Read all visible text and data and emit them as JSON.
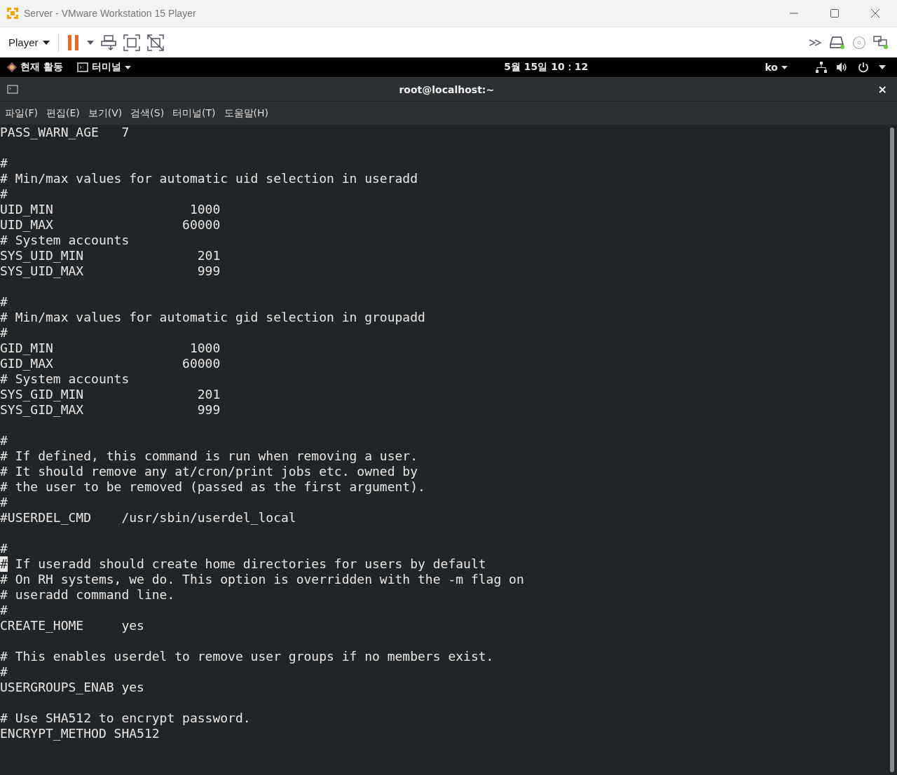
{
  "window": {
    "title": "Server - VMware Workstation 15 Player"
  },
  "toolbar": {
    "player_menu": "Player"
  },
  "top_bar": {
    "activities": "현재 활동",
    "app_menu": "터미널",
    "clock": "5월 15일  10：12",
    "language": "ko"
  },
  "terminal": {
    "title": "root@localhost:~",
    "close": "×",
    "menu": [
      "파일(F)",
      "편집(E)",
      "보기(V)",
      "검색(S)",
      "터미널(T)",
      "도움말(H)"
    ],
    "lines": [
      {
        "kind": "text",
        "text": "PASS_WARN_AGE   7"
      },
      {
        "kind": "blank"
      },
      {
        "kind": "text",
        "text": "#"
      },
      {
        "kind": "text",
        "text": "# Min/max values for automatic uid selection in useradd"
      },
      {
        "kind": "text",
        "text": "#"
      },
      {
        "kind": "text",
        "text": "UID_MIN                  1000"
      },
      {
        "kind": "text",
        "text": "UID_MAX                 60000"
      },
      {
        "kind": "text",
        "text": "# System accounts"
      },
      {
        "kind": "text",
        "text": "SYS_UID_MIN               201"
      },
      {
        "kind": "text",
        "text": "SYS_UID_MAX               999"
      },
      {
        "kind": "blank"
      },
      {
        "kind": "text",
        "text": "#"
      },
      {
        "kind": "text",
        "text": "# Min/max values for automatic gid selection in groupadd"
      },
      {
        "kind": "text",
        "text": "#"
      },
      {
        "kind": "text",
        "text": "GID_MIN                  1000"
      },
      {
        "kind": "text",
        "text": "GID_MAX                 60000"
      },
      {
        "kind": "text",
        "text": "# System accounts"
      },
      {
        "kind": "text",
        "text": "SYS_GID_MIN               201"
      },
      {
        "kind": "text",
        "text": "SYS_GID_MAX               999"
      },
      {
        "kind": "blank"
      },
      {
        "kind": "text",
        "text": "#"
      },
      {
        "kind": "text",
        "text": "# If defined, this command is run when removing a user."
      },
      {
        "kind": "text",
        "text": "# It should remove any at/cron/print jobs etc. owned by"
      },
      {
        "kind": "text",
        "text": "# the user to be removed (passed as the first argument)."
      },
      {
        "kind": "text",
        "text": "#"
      },
      {
        "kind": "text",
        "text": "#USERDEL_CMD    /usr/sbin/userdel_local"
      },
      {
        "kind": "blank"
      },
      {
        "kind": "text",
        "text": "#"
      },
      {
        "kind": "cursor",
        "cursor_char": "#",
        "text": " If useradd should create home directories for users by default"
      },
      {
        "kind": "text",
        "text": "# On RH systems, we do. This option is overridden with the -m flag on"
      },
      {
        "kind": "text",
        "text": "# useradd command line."
      },
      {
        "kind": "text",
        "text": "#"
      },
      {
        "kind": "text",
        "text": "CREATE_HOME     yes"
      },
      {
        "kind": "blank"
      },
      {
        "kind": "text",
        "text": "# This enables userdel to remove user groups if no members exist."
      },
      {
        "kind": "text",
        "text": "#"
      },
      {
        "kind": "text",
        "text": "USERGROUPS_ENAB yes"
      },
      {
        "kind": "blank"
      },
      {
        "kind": "text",
        "text": "# Use SHA512 to encrypt password."
      },
      {
        "kind": "text",
        "text": "ENCRYPT_METHOD SHA512"
      }
    ]
  }
}
